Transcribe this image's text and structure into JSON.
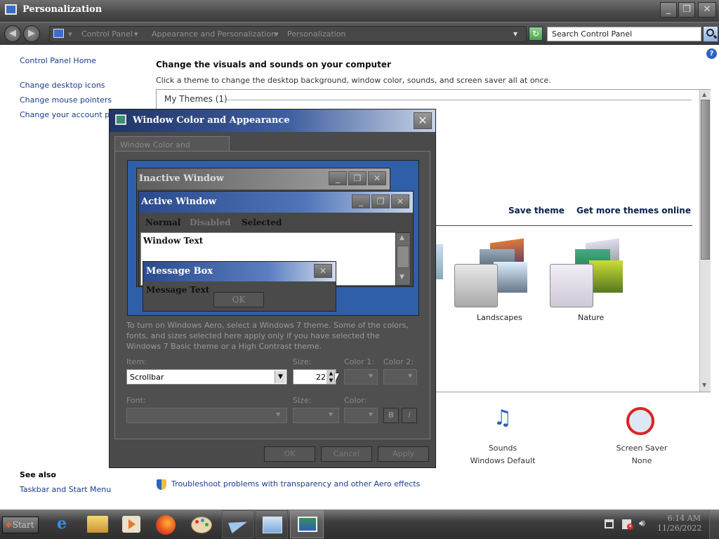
{
  "window": {
    "title": "Personalization"
  },
  "address": {
    "crumbs": [
      "Control Panel",
      "Appearance and Personalization",
      "Personalization"
    ],
    "search_placeholder": "Search Control Panel"
  },
  "leftnav": {
    "home": "Control Panel Home",
    "links": [
      "Change desktop icons",
      "Change mouse pointers",
      "Change your account pictu"
    ],
    "see_also": "See also",
    "see_also_links": [
      "Taskbar and Start Menu"
    ]
  },
  "main": {
    "heading": "Change the visuals and sounds on your computer",
    "subtitle": "Click a theme to change the desktop background, window color, sounds, and screen saver all at once.",
    "group_label": "My Themes (1)",
    "save_theme": "Save theme",
    "get_more": "Get more themes online",
    "themes": [
      "Landscapes",
      "Nature"
    ],
    "sounds": {
      "label": "Sounds",
      "value": "Windows Default"
    },
    "screensaver": {
      "label": "Screen Saver",
      "value": "None"
    },
    "troubleshoot": "Troubleshoot problems with transparency and other Aero effects"
  },
  "dialog": {
    "title": "Window Color and Appearance",
    "tab": "Window Color and Appearance",
    "preview": {
      "inactive": "Inactive Window",
      "active": "Active Window",
      "menu": [
        "Normal",
        "Disabled",
        "Selected"
      ],
      "window_text": "Window Text",
      "msgbox_title": "Message Box",
      "msgbox_text": "Message Text",
      "ok": "OK"
    },
    "info": "To turn on Windows Aero, select a Windows 7 theme.  Some of the colors, fonts, and sizes selected here apply only if you have selected the Windows 7 Basic theme or a High Contrast theme.",
    "labels": {
      "item": "Item:",
      "size": "Size:",
      "color1": "Color 1:",
      "color2": "Color 2:",
      "font": "Font:",
      "size2": "Size:",
      "color": "Color:"
    },
    "item_value": "Scrollbar",
    "size_value": "22",
    "bold": "B",
    "italic": "I",
    "buttons": {
      "ok": "OK",
      "cancel": "Cancel",
      "apply": "Apply"
    }
  },
  "taskbar": {
    "start": "Start",
    "time": "6:14 AM",
    "date": "11/26/2022"
  },
  "colors": {
    "title_dark": "#4a4a4a",
    "link": "#1a3c8f",
    "preview_blue": "#2f5fa8"
  }
}
